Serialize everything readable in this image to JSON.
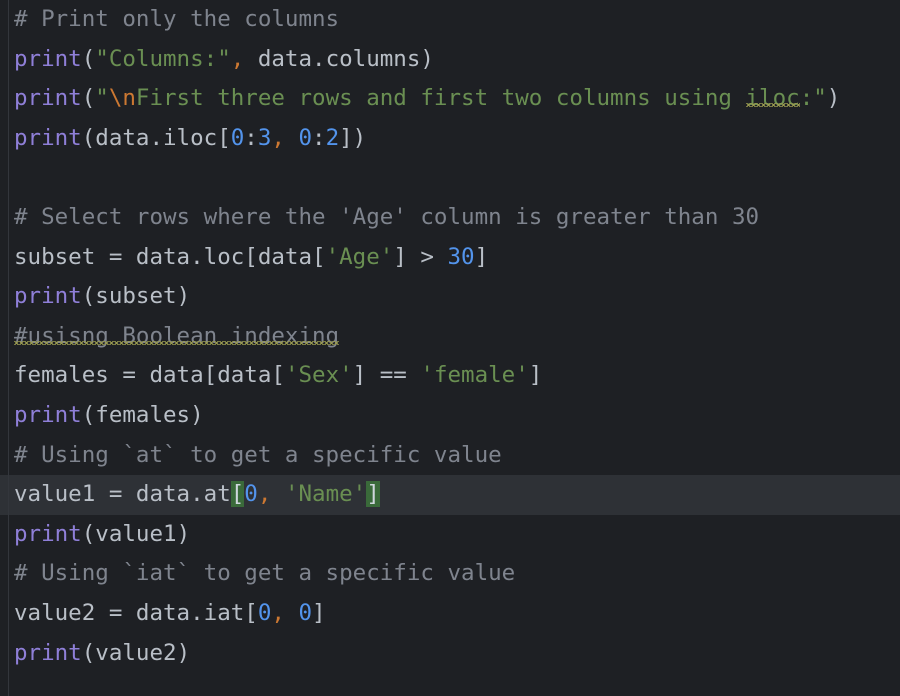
{
  "editor": {
    "language": "python",
    "theme_name": "dark",
    "colors": {
      "background": "#1e2024",
      "current_line": "#2e3136",
      "default_text": "#b9bfc7",
      "comment": "#7f848e",
      "function": "#8f7fd8",
      "string": "#6a8f52",
      "escape": "#cc7832",
      "number": "#5394ec",
      "comma": "#cc7832",
      "bracket_match_bg": "#3a6a3a",
      "squiggle": "#9a9a50",
      "gutter_rule": "#33363c"
    },
    "current_line_number": 13,
    "lines": [
      {
        "n": 1,
        "current": false,
        "tokens": [
          {
            "text": "# Print only the columns",
            "kind": "comment"
          }
        ]
      },
      {
        "n": 2,
        "current": false,
        "tokens": [
          {
            "text": "print",
            "kind": "fn"
          },
          {
            "text": "(",
            "kind": "punct"
          },
          {
            "text": "\"Columns:\"",
            "kind": "str"
          },
          {
            "text": ",",
            "kind": "comma"
          },
          {
            "text": " data",
            "kind": "ident"
          },
          {
            "text": ".",
            "kind": "punct"
          },
          {
            "text": "columns",
            "kind": "ident"
          },
          {
            "text": ")",
            "kind": "punct"
          }
        ]
      },
      {
        "n": 3,
        "current": false,
        "tokens": [
          {
            "text": "print",
            "kind": "fn"
          },
          {
            "text": "(",
            "kind": "punct"
          },
          {
            "text": "\"",
            "kind": "str"
          },
          {
            "text": "\\n",
            "kind": "esc"
          },
          {
            "text": "First three rows and first two columns using ",
            "kind": "str"
          },
          {
            "text": "iloc",
            "kind": "str",
            "squiggle": true
          },
          {
            "text": ":\"",
            "kind": "str"
          },
          {
            "text": ")",
            "kind": "punct"
          }
        ]
      },
      {
        "n": 4,
        "current": false,
        "tokens": [
          {
            "text": "print",
            "kind": "fn"
          },
          {
            "text": "(",
            "kind": "punct"
          },
          {
            "text": "data",
            "kind": "ident"
          },
          {
            "text": ".",
            "kind": "punct"
          },
          {
            "text": "iloc",
            "kind": "ident"
          },
          {
            "text": "[",
            "kind": "punct"
          },
          {
            "text": "0",
            "kind": "num"
          },
          {
            "text": ":",
            "kind": "punct"
          },
          {
            "text": "3",
            "kind": "num"
          },
          {
            "text": ",",
            "kind": "comma"
          },
          {
            "text": " ",
            "kind": "ident"
          },
          {
            "text": "0",
            "kind": "num"
          },
          {
            "text": ":",
            "kind": "punct"
          },
          {
            "text": "2",
            "kind": "num"
          },
          {
            "text": "])",
            "kind": "punct"
          }
        ]
      },
      {
        "n": 5,
        "current": false,
        "tokens": []
      },
      {
        "n": 6,
        "current": false,
        "tokens": [
          {
            "text": "# Select rows where the 'Age' column is greater than 30",
            "kind": "comment"
          }
        ]
      },
      {
        "n": 7,
        "current": false,
        "tokens": [
          {
            "text": "subset",
            "kind": "ident"
          },
          {
            "text": " = ",
            "kind": "op"
          },
          {
            "text": "data",
            "kind": "ident"
          },
          {
            "text": ".",
            "kind": "punct"
          },
          {
            "text": "loc",
            "kind": "ident"
          },
          {
            "text": "[",
            "kind": "punct"
          },
          {
            "text": "data",
            "kind": "ident"
          },
          {
            "text": "[",
            "kind": "punct"
          },
          {
            "text": "'Age'",
            "kind": "str"
          },
          {
            "text": "]",
            "kind": "punct"
          },
          {
            "text": " > ",
            "kind": "op"
          },
          {
            "text": "30",
            "kind": "num"
          },
          {
            "text": "]",
            "kind": "punct"
          }
        ]
      },
      {
        "n": 8,
        "current": false,
        "tokens": [
          {
            "text": "print",
            "kind": "fn"
          },
          {
            "text": "(",
            "kind": "punct"
          },
          {
            "text": "subset",
            "kind": "ident"
          },
          {
            "text": ")",
            "kind": "punct"
          }
        ]
      },
      {
        "n": 9,
        "current": false,
        "tokens": [
          {
            "text": "#usisng Boolean indexing",
            "kind": "comment",
            "squiggle": true
          }
        ]
      },
      {
        "n": 10,
        "current": false,
        "tokens": [
          {
            "text": "females",
            "kind": "ident"
          },
          {
            "text": " = ",
            "kind": "op"
          },
          {
            "text": "data",
            "kind": "ident"
          },
          {
            "text": "[",
            "kind": "punct"
          },
          {
            "text": "data",
            "kind": "ident"
          },
          {
            "text": "[",
            "kind": "punct"
          },
          {
            "text": "'Sex'",
            "kind": "str"
          },
          {
            "text": "]",
            "kind": "punct"
          },
          {
            "text": " == ",
            "kind": "op"
          },
          {
            "text": "'female'",
            "kind": "str"
          },
          {
            "text": "]",
            "kind": "punct"
          }
        ]
      },
      {
        "n": 11,
        "current": false,
        "tokens": [
          {
            "text": "print",
            "kind": "fn"
          },
          {
            "text": "(",
            "kind": "punct"
          },
          {
            "text": "females",
            "kind": "ident"
          },
          {
            "text": ")",
            "kind": "punct"
          }
        ]
      },
      {
        "n": 12,
        "current": false,
        "tokens": [
          {
            "text": "# Using `at` to get a specific value",
            "kind": "comment"
          }
        ]
      },
      {
        "n": 13,
        "current": true,
        "tokens": [
          {
            "text": "value1",
            "kind": "ident"
          },
          {
            "text": " = ",
            "kind": "op"
          },
          {
            "text": "data",
            "kind": "ident"
          },
          {
            "text": ".",
            "kind": "punct"
          },
          {
            "text": "at",
            "kind": "ident"
          },
          {
            "text": "[",
            "kind": "punct",
            "bracket_match": true
          },
          {
            "text": "0",
            "kind": "num"
          },
          {
            "text": ",",
            "kind": "comma"
          },
          {
            "text": " ",
            "kind": "ident"
          },
          {
            "text": "'Name'",
            "kind": "str"
          },
          {
            "text": "]",
            "kind": "punct",
            "bracket_match": true
          }
        ]
      },
      {
        "n": 14,
        "current": false,
        "tokens": [
          {
            "text": "print",
            "kind": "fn"
          },
          {
            "text": "(",
            "kind": "punct"
          },
          {
            "text": "value1",
            "kind": "ident"
          },
          {
            "text": ")",
            "kind": "punct"
          }
        ]
      },
      {
        "n": 15,
        "current": false,
        "tokens": [
          {
            "text": "# Using `iat` to get a specific value",
            "kind": "comment"
          }
        ]
      },
      {
        "n": 16,
        "current": false,
        "tokens": [
          {
            "text": "value2",
            "kind": "ident"
          },
          {
            "text": " = ",
            "kind": "op"
          },
          {
            "text": "data",
            "kind": "ident"
          },
          {
            "text": ".",
            "kind": "punct"
          },
          {
            "text": "iat",
            "kind": "ident"
          },
          {
            "text": "[",
            "kind": "punct"
          },
          {
            "text": "0",
            "kind": "num"
          },
          {
            "text": ",",
            "kind": "comma"
          },
          {
            "text": " ",
            "kind": "ident"
          },
          {
            "text": "0",
            "kind": "num"
          },
          {
            "text": "]",
            "kind": "punct"
          }
        ]
      },
      {
        "n": 17,
        "current": false,
        "tokens": [
          {
            "text": "print",
            "kind": "fn"
          },
          {
            "text": "(",
            "kind": "punct"
          },
          {
            "text": "value2",
            "kind": "ident"
          },
          {
            "text": ")",
            "kind": "punct"
          }
        ]
      }
    ]
  }
}
